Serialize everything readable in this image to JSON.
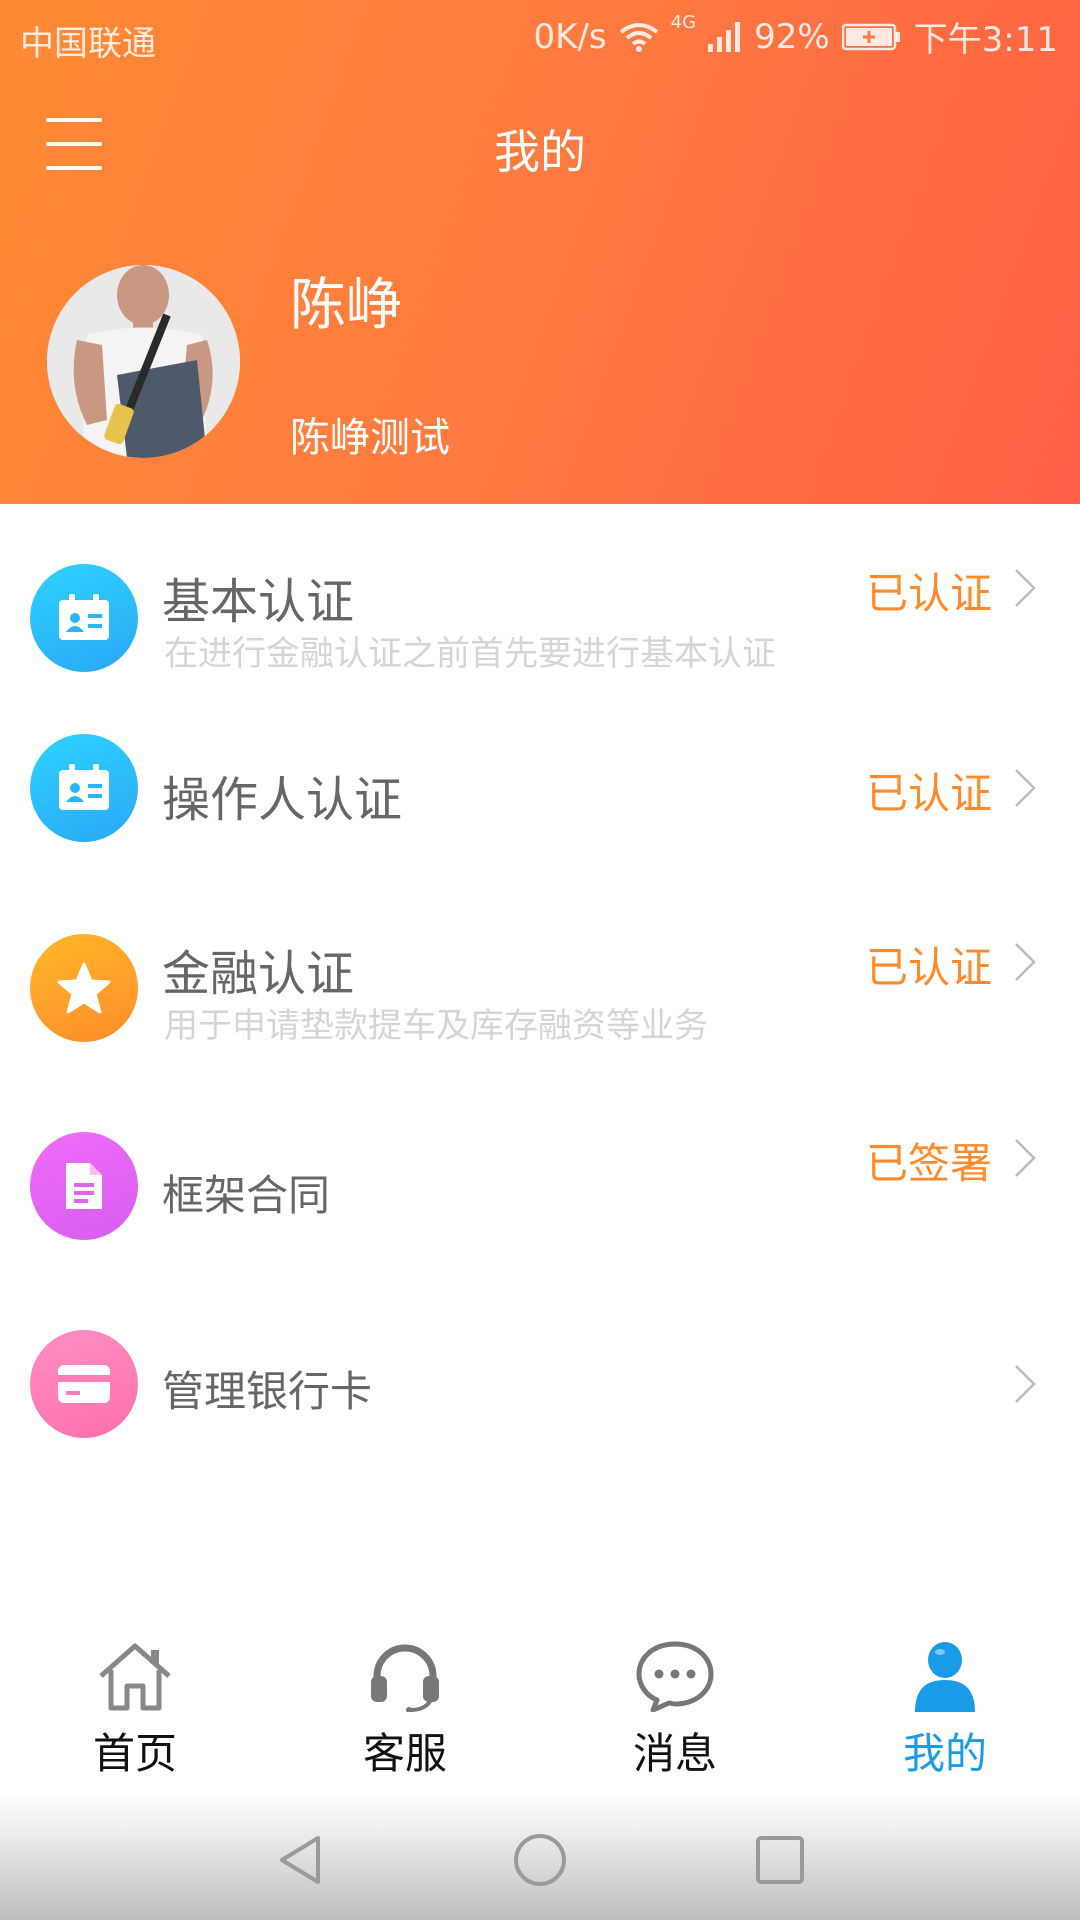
{
  "status_bar": {
    "carrier": "中国联通",
    "net_speed": "0K/s",
    "network": "4G",
    "battery": "92%",
    "time": "下午3:11"
  },
  "header": {
    "title": "我的",
    "menu_icon": "hamburger-icon",
    "gradient_colors": [
      "#ff8a33",
      "#ff5f45"
    ]
  },
  "profile": {
    "name": "陈峥",
    "subtitle": "陈峥测试"
  },
  "menu_items": [
    {
      "title": "基本认证",
      "description": "在进行金融认证之前首先要进行基本认证",
      "status": "已认证",
      "icon": "id-card-icon",
      "color": "#27c0f5"
    },
    {
      "title": "操作人认证",
      "description": "",
      "status": "已认证",
      "icon": "id-card-icon",
      "color": "#27c0f5"
    },
    {
      "title": "金融认证",
      "description": "用于申请垫款提车及库存融资等业务",
      "status": "已认证",
      "icon": "star-icon",
      "color": "#ffa02a"
    },
    {
      "title": "框架合同",
      "description": "",
      "status": "已签署",
      "icon": "document-icon",
      "color": "#e36cf0"
    },
    {
      "title": "管理银行卡",
      "description": "",
      "status": "",
      "icon": "bank-card-icon",
      "color": "#ff7eb6"
    }
  ],
  "tabs": [
    {
      "label": "首页",
      "icon": "home-icon",
      "active": false
    },
    {
      "label": "客服",
      "icon": "headset-icon",
      "active": false
    },
    {
      "label": "消息",
      "icon": "chat-bubble-icon",
      "active": false
    },
    {
      "label": "我的",
      "icon": "user-icon",
      "active": true
    }
  ],
  "colors": {
    "accent": "#ff8a2c",
    "tab_active": "#1a9be8"
  }
}
